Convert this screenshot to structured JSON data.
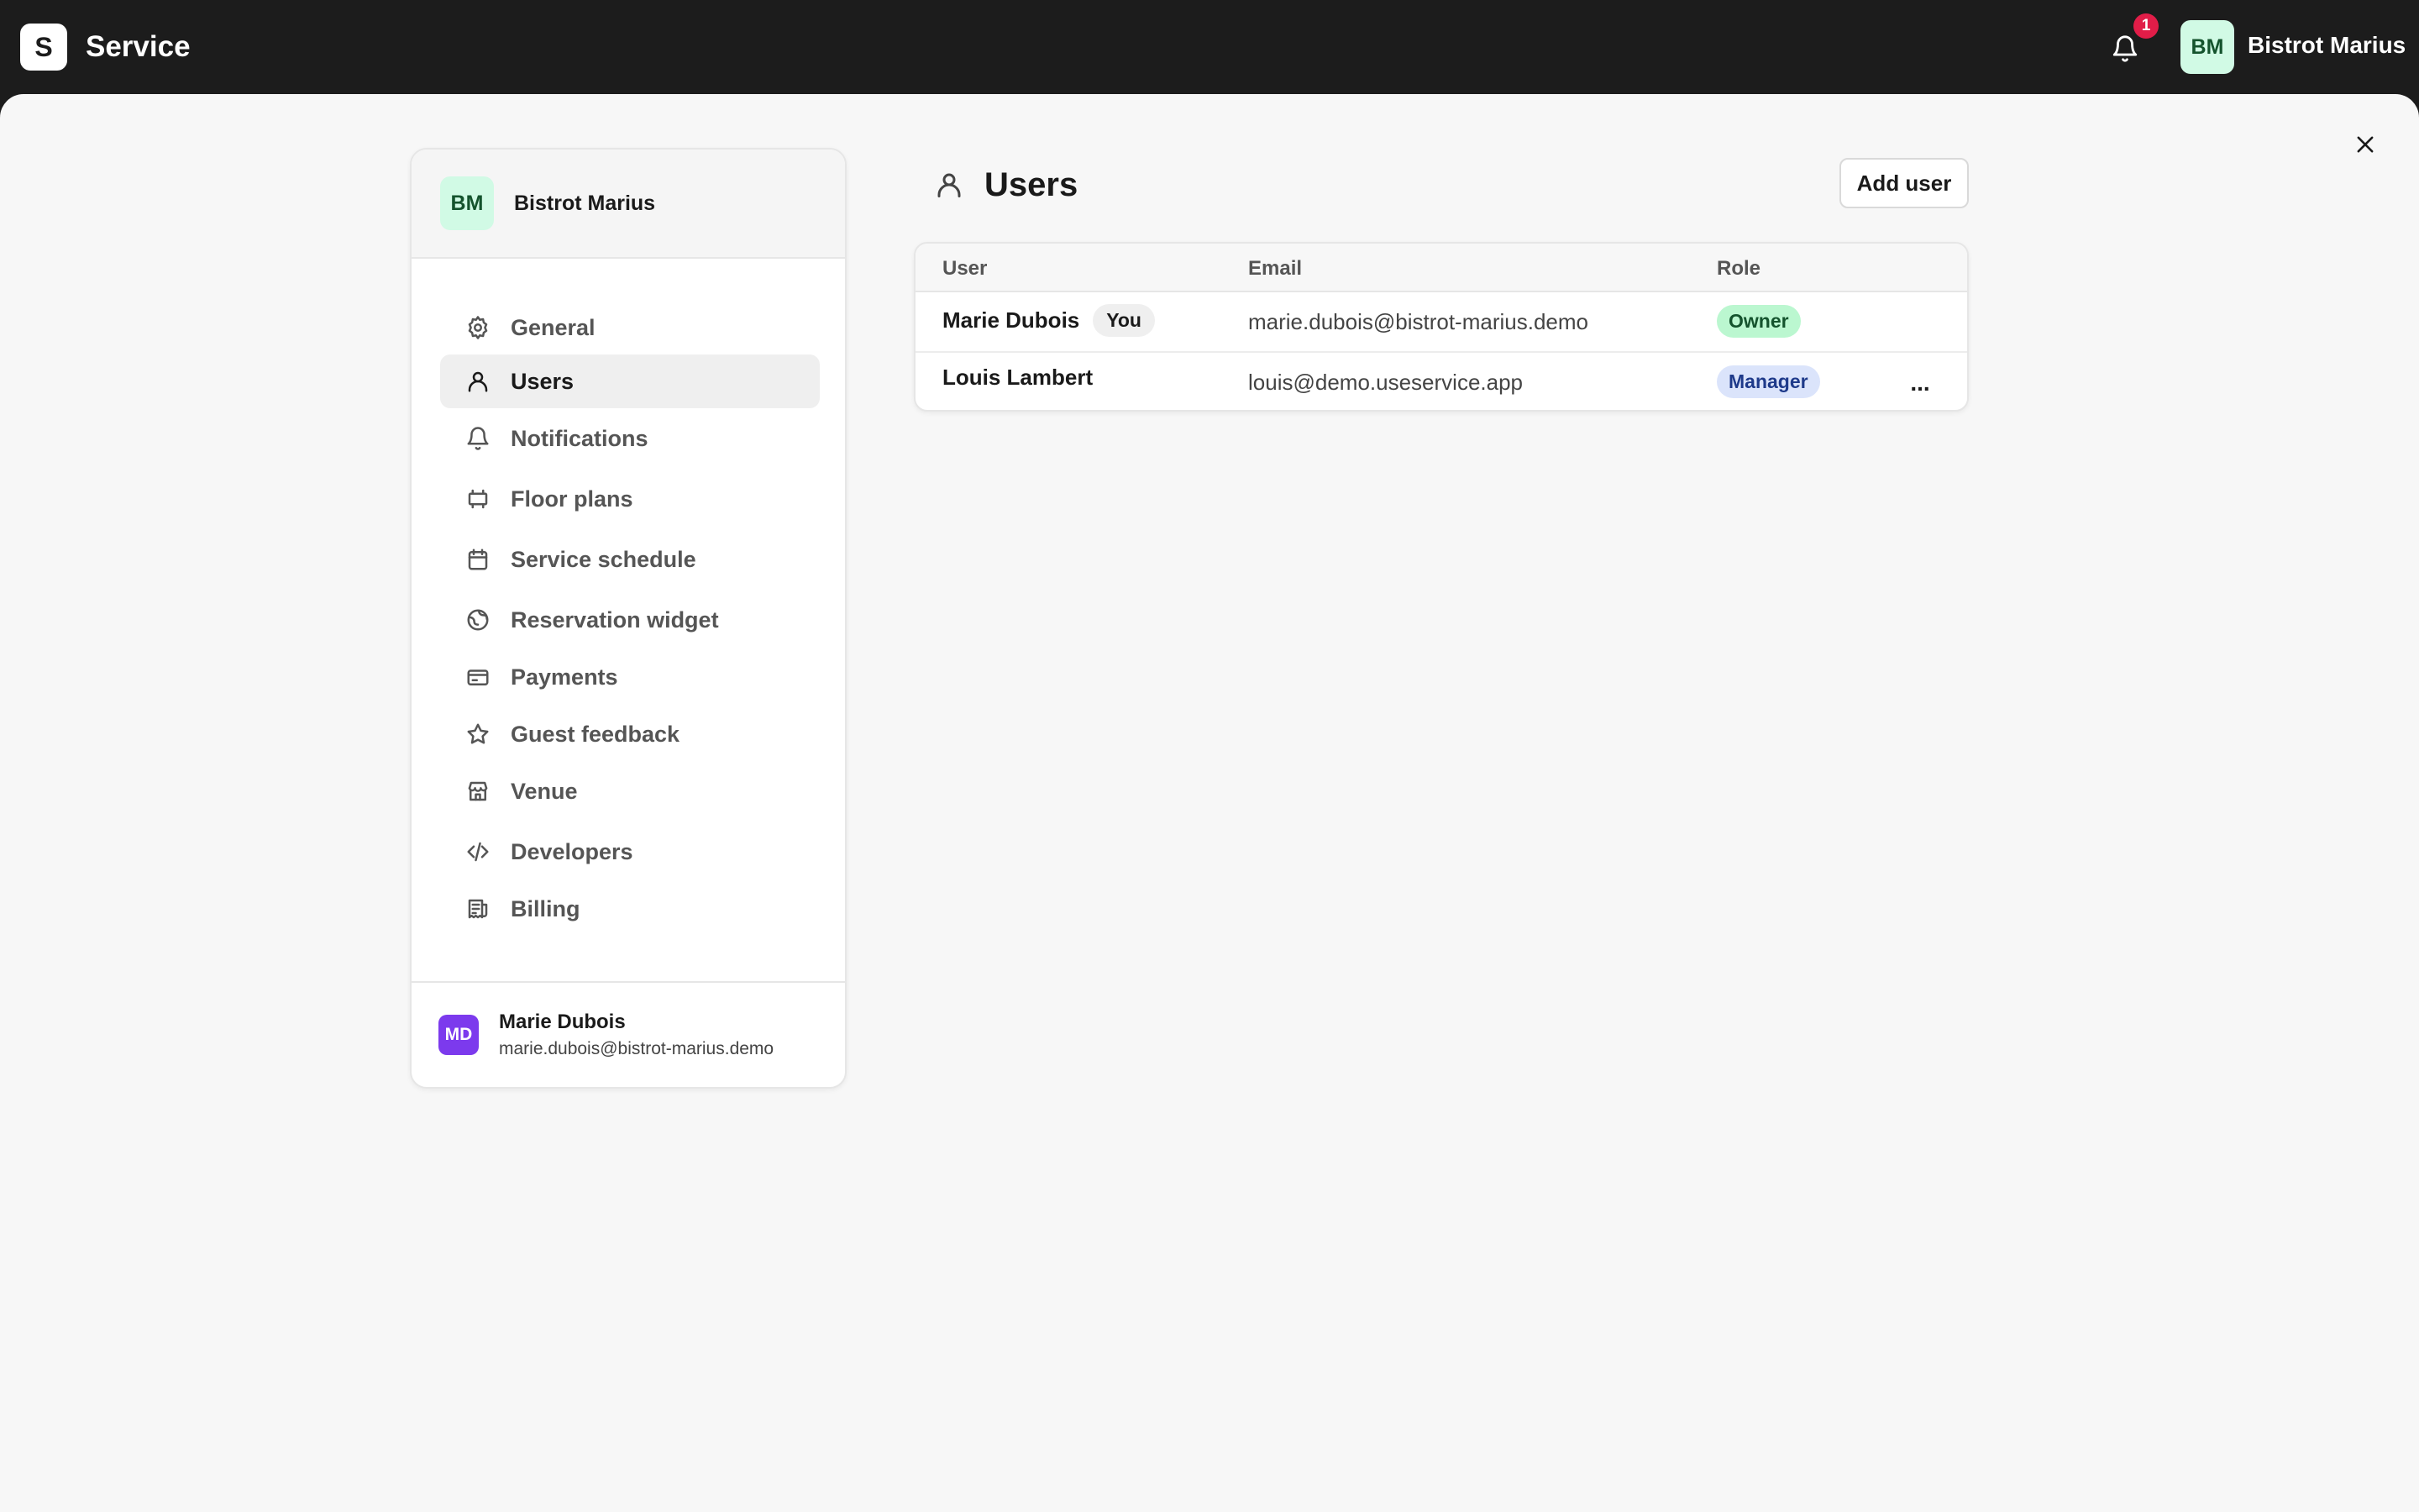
{
  "topbar": {
    "logo_letter": "S",
    "app_name": "Service",
    "notification_count": "1",
    "avatar_initials": "BM",
    "venue_name": "Bistrot Marius"
  },
  "sidebar": {
    "venue_initials": "BM",
    "venue_name": "Bistrot Marius",
    "items": [
      {
        "label": "General",
        "icon": "gear-icon"
      },
      {
        "label": "Users",
        "icon": "user-icon",
        "active": true
      },
      {
        "label": "Notifications",
        "icon": "bell-icon"
      },
      {
        "label": "Floor plans",
        "icon": "floor-plan-icon"
      },
      {
        "label": "Service schedule",
        "icon": "calendar-icon"
      },
      {
        "label": "Reservation widget",
        "icon": "globe-icon"
      },
      {
        "label": "Payments",
        "icon": "credit-card-icon"
      },
      {
        "label": "Guest feedback",
        "icon": "star-icon"
      },
      {
        "label": "Venue",
        "icon": "store-icon"
      },
      {
        "label": "Developers",
        "icon": "code-icon"
      },
      {
        "label": "Billing",
        "icon": "receipt-icon"
      }
    ],
    "footer": {
      "initials": "MD",
      "name": "Marie Dubois",
      "email": "marie.dubois@bistrot-marius.demo"
    }
  },
  "main": {
    "title": "Users",
    "add_button_label": "Add user",
    "table": {
      "columns": [
        "User",
        "Email",
        "Role"
      ],
      "rows": [
        {
          "name": "Marie Dubois",
          "badge": "You",
          "email": "marie.dubois@bistrot-marius.demo",
          "role": "Owner"
        },
        {
          "name": "Louis Lambert",
          "badge": "",
          "email": "louis@demo.useservice.app",
          "role": "Manager",
          "more": "..."
        }
      ]
    }
  },
  "colors": {
    "topbar_bg": "#1c1c1c",
    "sheet_bg": "#f7f7f7",
    "owner_badge": "#bbf7d0",
    "manager_badge": "#dbe4fb",
    "notification_badge": "#e11d48",
    "footer_avatar": "#7c3aed"
  }
}
